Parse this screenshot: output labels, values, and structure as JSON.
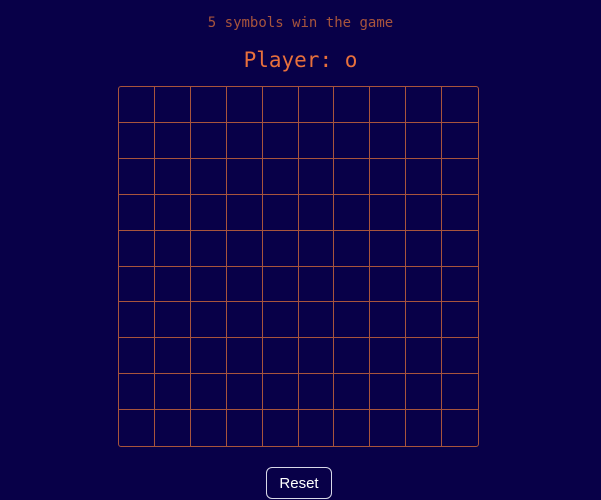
{
  "game": {
    "rule_text": "5 symbols win the game",
    "player_text": "Player: o",
    "board": {
      "rows": 10,
      "cols": 10,
      "cells": [
        [
          "",
          "",
          "",
          "",
          "",
          "",
          "",
          "",
          "",
          ""
        ],
        [
          "",
          "",
          "",
          "",
          "",
          "",
          "",
          "",
          "",
          ""
        ],
        [
          "",
          "",
          "",
          "",
          "",
          "",
          "",
          "",
          "",
          ""
        ],
        [
          "",
          "",
          "",
          "",
          "",
          "",
          "",
          "",
          "",
          ""
        ],
        [
          "",
          "",
          "",
          "",
          "",
          "",
          "",
          "",
          "",
          ""
        ],
        [
          "",
          "",
          "",
          "",
          "",
          "",
          "",
          "",
          "",
          ""
        ],
        [
          "",
          "",
          "",
          "",
          "",
          "",
          "",
          "",
          "",
          ""
        ],
        [
          "",
          "",
          "",
          "",
          "",
          "",
          "",
          "",
          "",
          ""
        ],
        [
          "",
          "",
          "",
          "",
          "",
          "",
          "",
          "",
          "",
          ""
        ],
        [
          "",
          "",
          "",
          "",
          "",
          "",
          "",
          "",
          "",
          ""
        ]
      ]
    },
    "reset_label": "Reset"
  },
  "colors": {
    "background": "#080048",
    "accent": "#e8703c",
    "grid_line": "#a8543c",
    "button_border": "#d8d8e8",
    "button_text": "#ffffff"
  }
}
